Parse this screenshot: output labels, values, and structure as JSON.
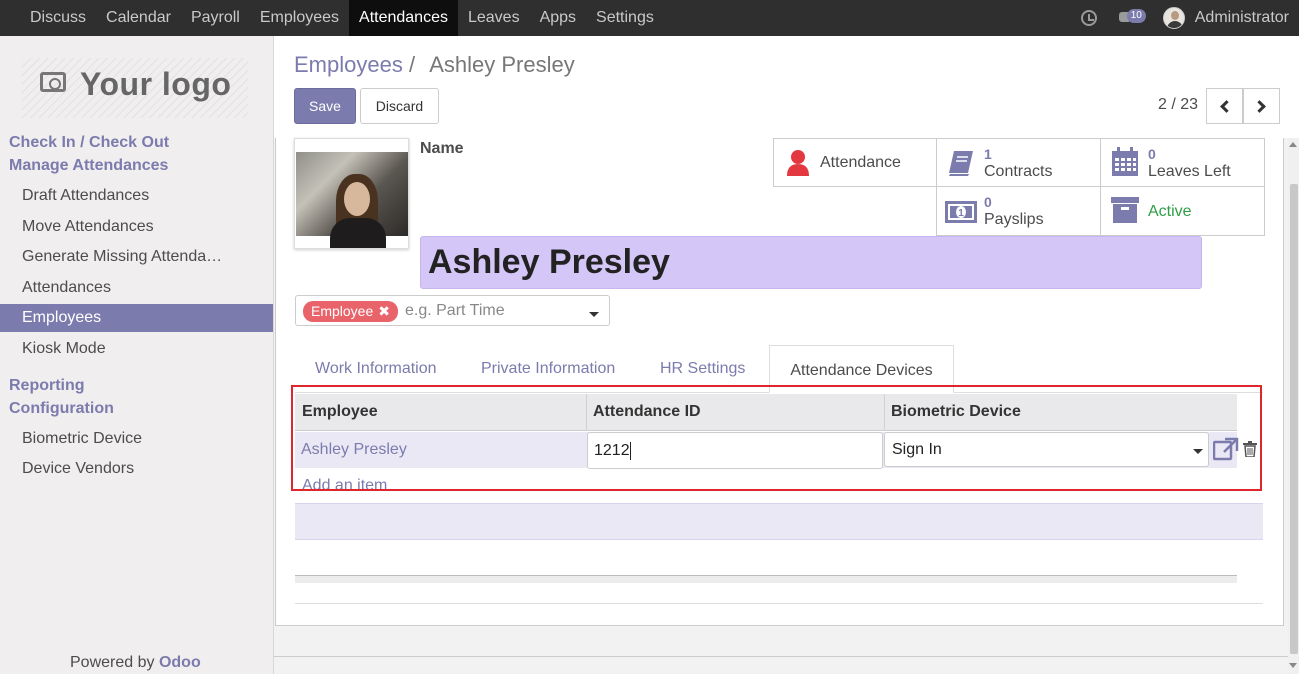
{
  "nav": {
    "items": [
      "Discuss",
      "Calendar",
      "Payroll",
      "Employees",
      "Attendances",
      "Leaves",
      "Apps",
      "Settings"
    ],
    "active_index": 4,
    "message_count": "10",
    "user": "Administrator"
  },
  "sidebar": {
    "logo_text": "Your logo",
    "sections": [
      {
        "title": "Check In / Check Out"
      },
      {
        "title": "Manage Attendances"
      },
      {
        "title": "Reporting"
      },
      {
        "title": "Configuration"
      }
    ],
    "items": [
      {
        "label": "Draft Attendances"
      },
      {
        "label": "Move Attendances"
      },
      {
        "label": "Generate Missing Attenda…"
      },
      {
        "label": "Attendances"
      },
      {
        "label": "Employees"
      },
      {
        "label": "Kiosk Mode"
      },
      {
        "label": "Biometric Device"
      },
      {
        "label": "Device Vendors"
      }
    ],
    "active_item": "Employees",
    "powered_by": "Powered by",
    "powered_brand": "Odoo"
  },
  "breadcrumb": {
    "parent": "Employees",
    "separator": "/",
    "current": "Ashley Presley"
  },
  "toolbar": {
    "save_label": "Save",
    "discard_label": "Discard",
    "pager": "2 / 23"
  },
  "employee": {
    "name_label": "Name",
    "name": "Ashley Presley",
    "tag": "Employee",
    "tag_placeholder": "e.g. Part Time"
  },
  "smart_buttons": {
    "attendance": {
      "label": "Attendance",
      "icon": "user-icon"
    },
    "contracts": {
      "count": "1",
      "label": "Contracts",
      "icon": "book-icon"
    },
    "leaves": {
      "count": "0",
      "label": "Leaves Left",
      "icon": "calendar-icon"
    },
    "payslips": {
      "count": "0",
      "label": "Payslips",
      "icon": "money-icon"
    },
    "active": {
      "label": "Active",
      "icon": "archive-icon"
    }
  },
  "tabs": [
    "Work Information",
    "Private Information",
    "HR Settings",
    "Attendance Devices"
  ],
  "active_tab": "Attendance Devices",
  "table": {
    "headers": [
      "Employee",
      "Attendance ID",
      "Biometric Device"
    ],
    "rows": [
      {
        "employee": "Ashley Presley",
        "attendance_id": "1212",
        "device": "Sign In"
      }
    ],
    "add_item": "Add an item"
  },
  "colors": {
    "accent": "#7c7bad",
    "navbar": "#2f2f2f",
    "tag": "#e9636b",
    "name_field": "#d4c6f7",
    "highlight_box": "#e0262d",
    "active_status": "#2f9e44"
  }
}
